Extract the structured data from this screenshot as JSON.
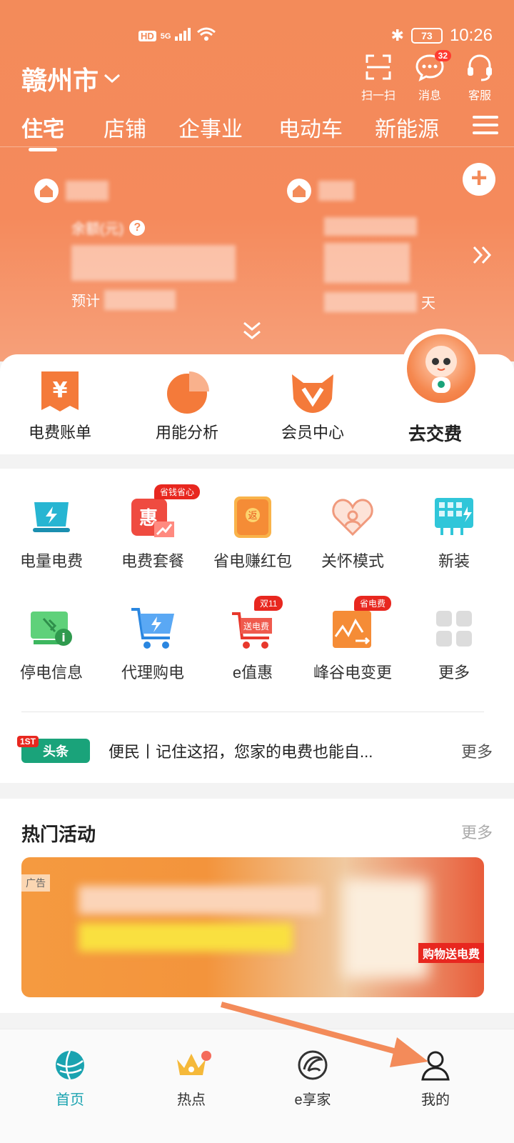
{
  "status_bar": {
    "network": "HD",
    "signal": "5G",
    "battery": "73",
    "time": "10:26"
  },
  "header": {
    "city": "赣州市",
    "actions": [
      {
        "label": "扫一扫",
        "icon": "scan-icon"
      },
      {
        "label": "消息",
        "icon": "message-icon",
        "badge": "32"
      },
      {
        "label": "客服",
        "icon": "headset-icon"
      }
    ]
  },
  "tabs": [
    "住宅",
    "店铺",
    "企事业",
    "电动车",
    "新能源"
  ],
  "account": {
    "balance_label": "余额(元)",
    "prepay_label": "预计",
    "days_label": "天"
  },
  "quick": {
    "items": [
      {
        "label": "电费账单",
        "icon": "bill-icon"
      },
      {
        "label": "用能分析",
        "icon": "pie-chart-icon"
      },
      {
        "label": "会员中心",
        "icon": "member-icon"
      }
    ],
    "pay_label": "去交费"
  },
  "grid": {
    "items": [
      {
        "label": "电量电费",
        "icon": "electricity-icon",
        "tag": ""
      },
      {
        "label": "电费套餐",
        "icon": "discount-icon",
        "tag": "省钱省心"
      },
      {
        "label": "省电赚红包",
        "icon": "red-packet-icon",
        "tag": ""
      },
      {
        "label": "关怀模式",
        "icon": "care-icon",
        "tag": ""
      },
      {
        "label": "新装",
        "icon": "new-install-icon",
        "tag": ""
      },
      {
        "label": "停电信息",
        "icon": "outage-icon",
        "tag": ""
      },
      {
        "label": "代理购电",
        "icon": "cart-icon",
        "tag": ""
      },
      {
        "label": "e值惠",
        "icon": "e-cart-icon",
        "tag": "双11",
        "inner": "送电费"
      },
      {
        "label": "峰谷电变更",
        "icon": "peak-valley-icon",
        "tag": "省电费"
      },
      {
        "label": "更多",
        "icon": "more-grid-icon",
        "tag": ""
      }
    ]
  },
  "news": {
    "logo": "头条",
    "logo_badge": "1ST",
    "text": "便民丨记住这招，您家的电费也能自...",
    "more": "更多"
  },
  "activities": {
    "title": "热门活动",
    "more": "更多",
    "ad_tag": "广告",
    "banner_tag": "购物送电费"
  },
  "bottom_nav": [
    {
      "label": "首页",
      "icon": "home-globe-icon",
      "active": true
    },
    {
      "label": "热点",
      "icon": "crown-icon",
      "active": false
    },
    {
      "label": "e享家",
      "icon": "e-home-icon",
      "active": false
    },
    {
      "label": "我的",
      "icon": "profile-icon",
      "active": false
    }
  ],
  "colors": {
    "brand": "#f38b5a",
    "accent": "#1aa3b0",
    "red": "#e8271f"
  }
}
